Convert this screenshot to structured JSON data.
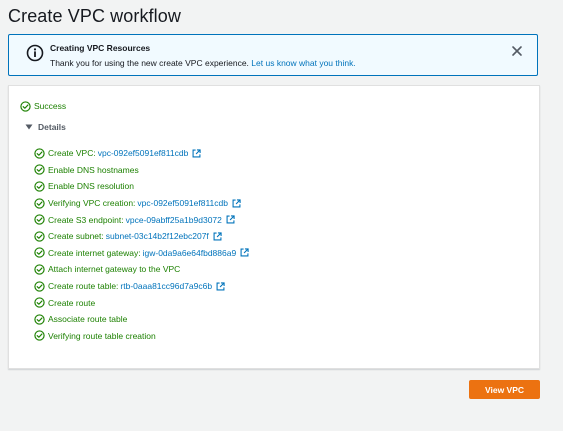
{
  "page": {
    "title": "Create VPC workflow"
  },
  "banner": {
    "title": "Creating VPC Resources",
    "message": "Thank you for using the new create VPC experience.",
    "link_text": "Let us know what you think.",
    "icon": "info-icon",
    "close_icon": "close-icon"
  },
  "status": {
    "text": "Success",
    "icon": "check-circle-icon"
  },
  "details": {
    "label": "Details",
    "expanded": true
  },
  "steps": [
    {
      "label": "Create VPC:",
      "link": "vpc-092ef5091ef811cdb",
      "external": true
    },
    {
      "label": "Enable DNS hostnames",
      "link": "",
      "external": false
    },
    {
      "label": "Enable DNS resolution",
      "link": "",
      "external": false
    },
    {
      "label": "Verifying VPC creation:",
      "link": "vpc-092ef5091ef811cdb",
      "external": true
    },
    {
      "label": "Create S3 endpoint:",
      "link": "vpce-09abff25a1b9d3072",
      "external": true
    },
    {
      "label": "Create subnet:",
      "link": "subnet-03c14b2f12ebc207f",
      "external": true
    },
    {
      "label": "Create internet gateway:",
      "link": "igw-0da9a6e64fbd886a9",
      "external": true
    },
    {
      "label": "Attach internet gateway to the VPC",
      "link": "",
      "external": false
    },
    {
      "label": "Create route table:",
      "link": "rtb-0aaa81cc96d7a9c6b",
      "external": true
    },
    {
      "label": "Create route",
      "link": "",
      "external": false
    },
    {
      "label": "Associate route table",
      "link": "",
      "external": false
    },
    {
      "label": "Verifying route table creation",
      "link": "",
      "external": false
    }
  ],
  "actions": {
    "view_vpc_label": "View VPC"
  },
  "colors": {
    "success": "#1d8102",
    "link": "#0073bb",
    "primary_button": "#ec7211",
    "banner_bg": "#f1faff",
    "banner_border": "#0073bb"
  }
}
